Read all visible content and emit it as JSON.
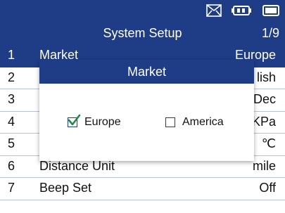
{
  "header": {
    "title": "System Setup",
    "page": "1/9"
  },
  "status_icons": [
    "mail-icon",
    "battery-icon",
    "power-icon"
  ],
  "rows": [
    {
      "num": "1",
      "label": "Market",
      "value": "Europe",
      "selected": true
    },
    {
      "num": "2",
      "label": "",
      "value": "lish"
    },
    {
      "num": "3",
      "label": "",
      "value": "Dec"
    },
    {
      "num": "4",
      "label": "",
      "value": "KPa"
    },
    {
      "num": "5",
      "label": "",
      "value": "℃"
    },
    {
      "num": "6",
      "label": "Distance Unit",
      "value": "mile"
    },
    {
      "num": "7",
      "label": "Beep Set",
      "value": "Off"
    }
  ],
  "dialog": {
    "title": "Market",
    "options": [
      {
        "label": "Europe",
        "checked": true
      },
      {
        "label": "America",
        "checked": false
      }
    ]
  },
  "colors": {
    "accent": "#1f3c87",
    "divider": "#b7c1d6",
    "text": "#111111",
    "background": "#ffffff"
  }
}
